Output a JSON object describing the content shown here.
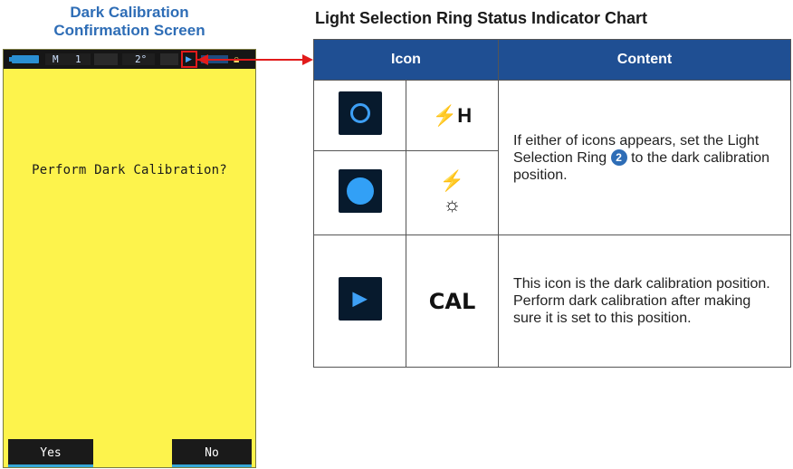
{
  "left_caption": {
    "line1": "Dark Calibration",
    "line2": "Confirmation Screen"
  },
  "device": {
    "status_bar": {
      "mode": "M",
      "mode_index": "1",
      "angle": "2°",
      "cal_icon": "dark-calibration-icon",
      "lock_icon": "lock-icon"
    },
    "prompt": "Perform Dark Calibration?",
    "buttons": {
      "yes": "Yes",
      "no": "No"
    }
  },
  "chart": {
    "title": "Light Selection Ring Status Indicator Chart",
    "headers": {
      "icon": "Icon",
      "content": "Content"
    },
    "rows": [
      {
        "icon": "ring-outline-icon",
        "symbol": "⚡H",
        "content_pre": "If either of icons appears, set the Light Selection Ring",
        "ring_number": "2",
        "content_post": "to the dark calibration position."
      },
      {
        "icon": "ring-filled-icon",
        "symbol_top": "⚡",
        "symbol_bottom": "☼"
      },
      {
        "icon": "dark-calibration-icon",
        "symbol": "CAL",
        "content_line1": "This icon is the dark calibration position.",
        "content_line2": "Perform dark calibration after making sure it is set to this position."
      }
    ]
  },
  "colors": {
    "caption_blue": "#2e6db6",
    "header_blue": "#1f4f93",
    "screen_yellow": "#fdf34c",
    "arrow_red": "#e11b1b",
    "icon_blue": "#3d9ff5"
  }
}
